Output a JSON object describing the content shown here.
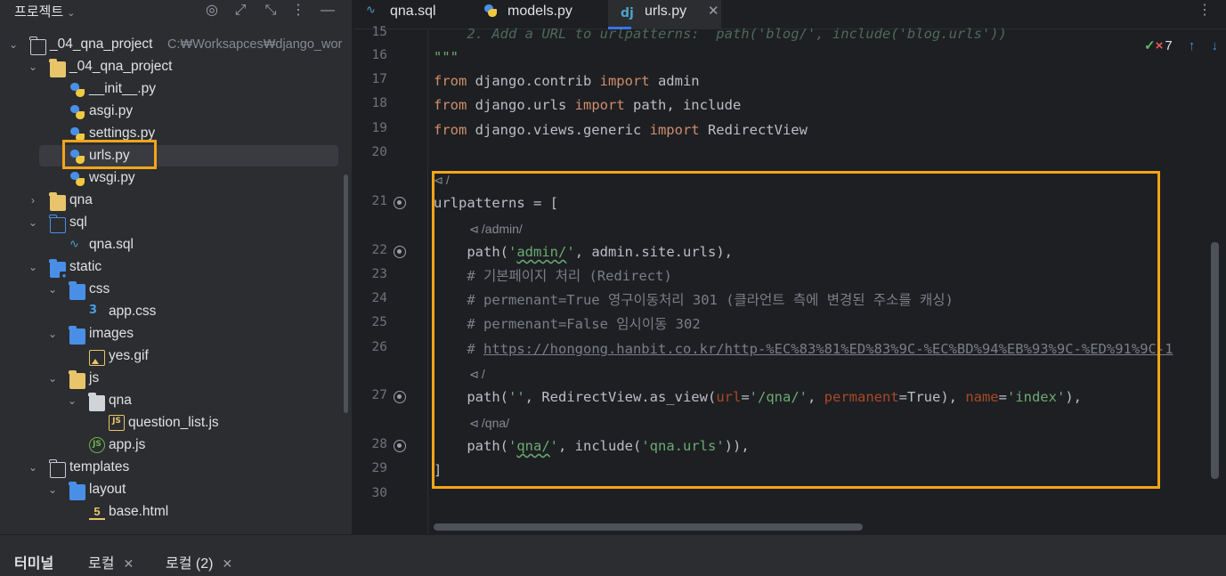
{
  "project_panel": {
    "title": "프로젝트",
    "tree": [
      {
        "label": "_04_qna_project",
        "path": "C:₩Worksapces₩django_wor",
        "indent": 0,
        "expanded": true,
        "icon": "folder-outline-icon"
      },
      {
        "label": "_04_qna_project",
        "indent": 1,
        "expanded": true,
        "icon": "folder-yellow-icon"
      },
      {
        "label": "__init__.py",
        "indent": 2,
        "icon": "python-icon"
      },
      {
        "label": "asgi.py",
        "indent": 2,
        "icon": "python-icon"
      },
      {
        "label": "settings.py",
        "indent": 2,
        "icon": "python-icon"
      },
      {
        "label": "urls.py",
        "indent": 2,
        "icon": "python-icon",
        "selected": true
      },
      {
        "label": "wsgi.py",
        "indent": 2,
        "icon": "python-icon"
      },
      {
        "label": "qna",
        "indent": 1,
        "expanded": false,
        "icon": "folder-yellow-icon"
      },
      {
        "label": "sql",
        "indent": 1,
        "expanded": true,
        "icon": "folder-sql-icon"
      },
      {
        "label": "qna.sql",
        "indent": 2,
        "icon": "sql-file-icon"
      },
      {
        "label": "static",
        "indent": 1,
        "expanded": true,
        "icon": "folder-web-icon"
      },
      {
        "label": "css",
        "indent": 2,
        "expanded": true,
        "icon": "folder-blue-icon"
      },
      {
        "label": "app.css",
        "indent": 3,
        "icon": "css-icon"
      },
      {
        "label": "images",
        "indent": 2,
        "expanded": true,
        "icon": "folder-images-icon"
      },
      {
        "label": "yes.gif",
        "indent": 3,
        "icon": "image-icon"
      },
      {
        "label": "js",
        "indent": 2,
        "expanded": true,
        "icon": "folder-js-icon"
      },
      {
        "label": "qna",
        "indent": 3,
        "expanded": true,
        "icon": "folder-gray-icon"
      },
      {
        "label": "question_list.js",
        "indent": 4,
        "icon": "js-file-icon"
      },
      {
        "label": "app.js",
        "indent": 3,
        "icon": "nodejs-icon"
      },
      {
        "label": "templates",
        "indent": 1,
        "expanded": true,
        "icon": "folder-outline-icon"
      },
      {
        "label": "layout",
        "indent": 2,
        "expanded": true,
        "icon": "folder-blue-icon"
      },
      {
        "label": "base.html",
        "indent": 3,
        "icon": "html-icon"
      }
    ]
  },
  "tabs": [
    {
      "label": "qna.sql",
      "icon": "sql-file-icon"
    },
    {
      "label": "models.py",
      "icon": "python-icon"
    },
    {
      "label": "urls.py",
      "icon": "django-icon",
      "active": true
    }
  ],
  "inspections": {
    "warnings": "7"
  },
  "code": {
    "lines": [
      {
        "n": "15",
        "html": "<span class=\"fade\">    2. Add a URL to urlpatterns:  path('blog/', include('blog.urls'))</span>"
      },
      {
        "n": "16",
        "html": "<span class=\"str\">\"\"\"</span>"
      },
      {
        "n": "17",
        "html": "<span class=\"kw\">from</span> django.contrib <span class=\"kw\">import</span> admin"
      },
      {
        "n": "18",
        "html": "<span class=\"kw\">from</span> django.urls <span class=\"kw\">import</span> path, include"
      },
      {
        "n": "19",
        "html": "<span class=\"kw\">from</span> django.views.generic <span class=\"kw\">import</span> RedirectView"
      },
      {
        "n": "20",
        "html": ""
      },
      {
        "n": "",
        "hint": "/"
      },
      {
        "n": "21",
        "gutter": true,
        "html": "urlpatterns = ["
      },
      {
        "n": "",
        "hint": "/admin/"
      },
      {
        "n": "22",
        "gutter": true,
        "html": "    path(<span class=\"str\">'<span class=\"uline-green\">admin/</span>'</span>, admin.site.urls),"
      },
      {
        "n": "23",
        "html": "    <span class=\"cm\"># 기본페이지 처리 (Redirect)</span>"
      },
      {
        "n": "24",
        "html": "    <span class=\"cm\"># permenant=True 영구이동처리 301 (클라언트 측에 변경된 주소를 캐싱)</span>"
      },
      {
        "n": "25",
        "html": "    <span class=\"cm\"># permenant=False 임시이동 302</span>"
      },
      {
        "n": "26",
        "html": "    <span class=\"cm\"># <span class=\"link-text\">https://hongong.hanbit.co.kr/http-%EC%83%81%ED%83%9C-%EC%BD%94%EB%93%9C-%ED%91%9C-1</span></span>"
      },
      {
        "n": "",
        "hint": "/"
      },
      {
        "n": "27",
        "gutter": true,
        "html": "    path(<span class=\"str\">''</span>, RedirectView.as_view(<span class=\"param\">url</span>=<span class=\"str\">'/qna/'</span>, <span class=\"param\">permanent</span>=True), <span class=\"param\">name</span>=<span class=\"str\">'index'</span>),"
      },
      {
        "n": "",
        "hint": "/qna/"
      },
      {
        "n": "28",
        "gutter": true,
        "html": "    path(<span class=\"str\">'<span class=\"uline-green\">qna/</span>'</span>, include(<span class=\"str\">'qna.urls'</span>)),"
      },
      {
        "n": "29",
        "html": "]"
      },
      {
        "n": "30",
        "html": ""
      }
    ]
  },
  "bottom_panel": {
    "title": "터미널",
    "tabs": [
      "로컬",
      "로컬 (2)"
    ]
  },
  "colors": {
    "highlight": "#f6a41a",
    "accent": "#3574f0"
  }
}
